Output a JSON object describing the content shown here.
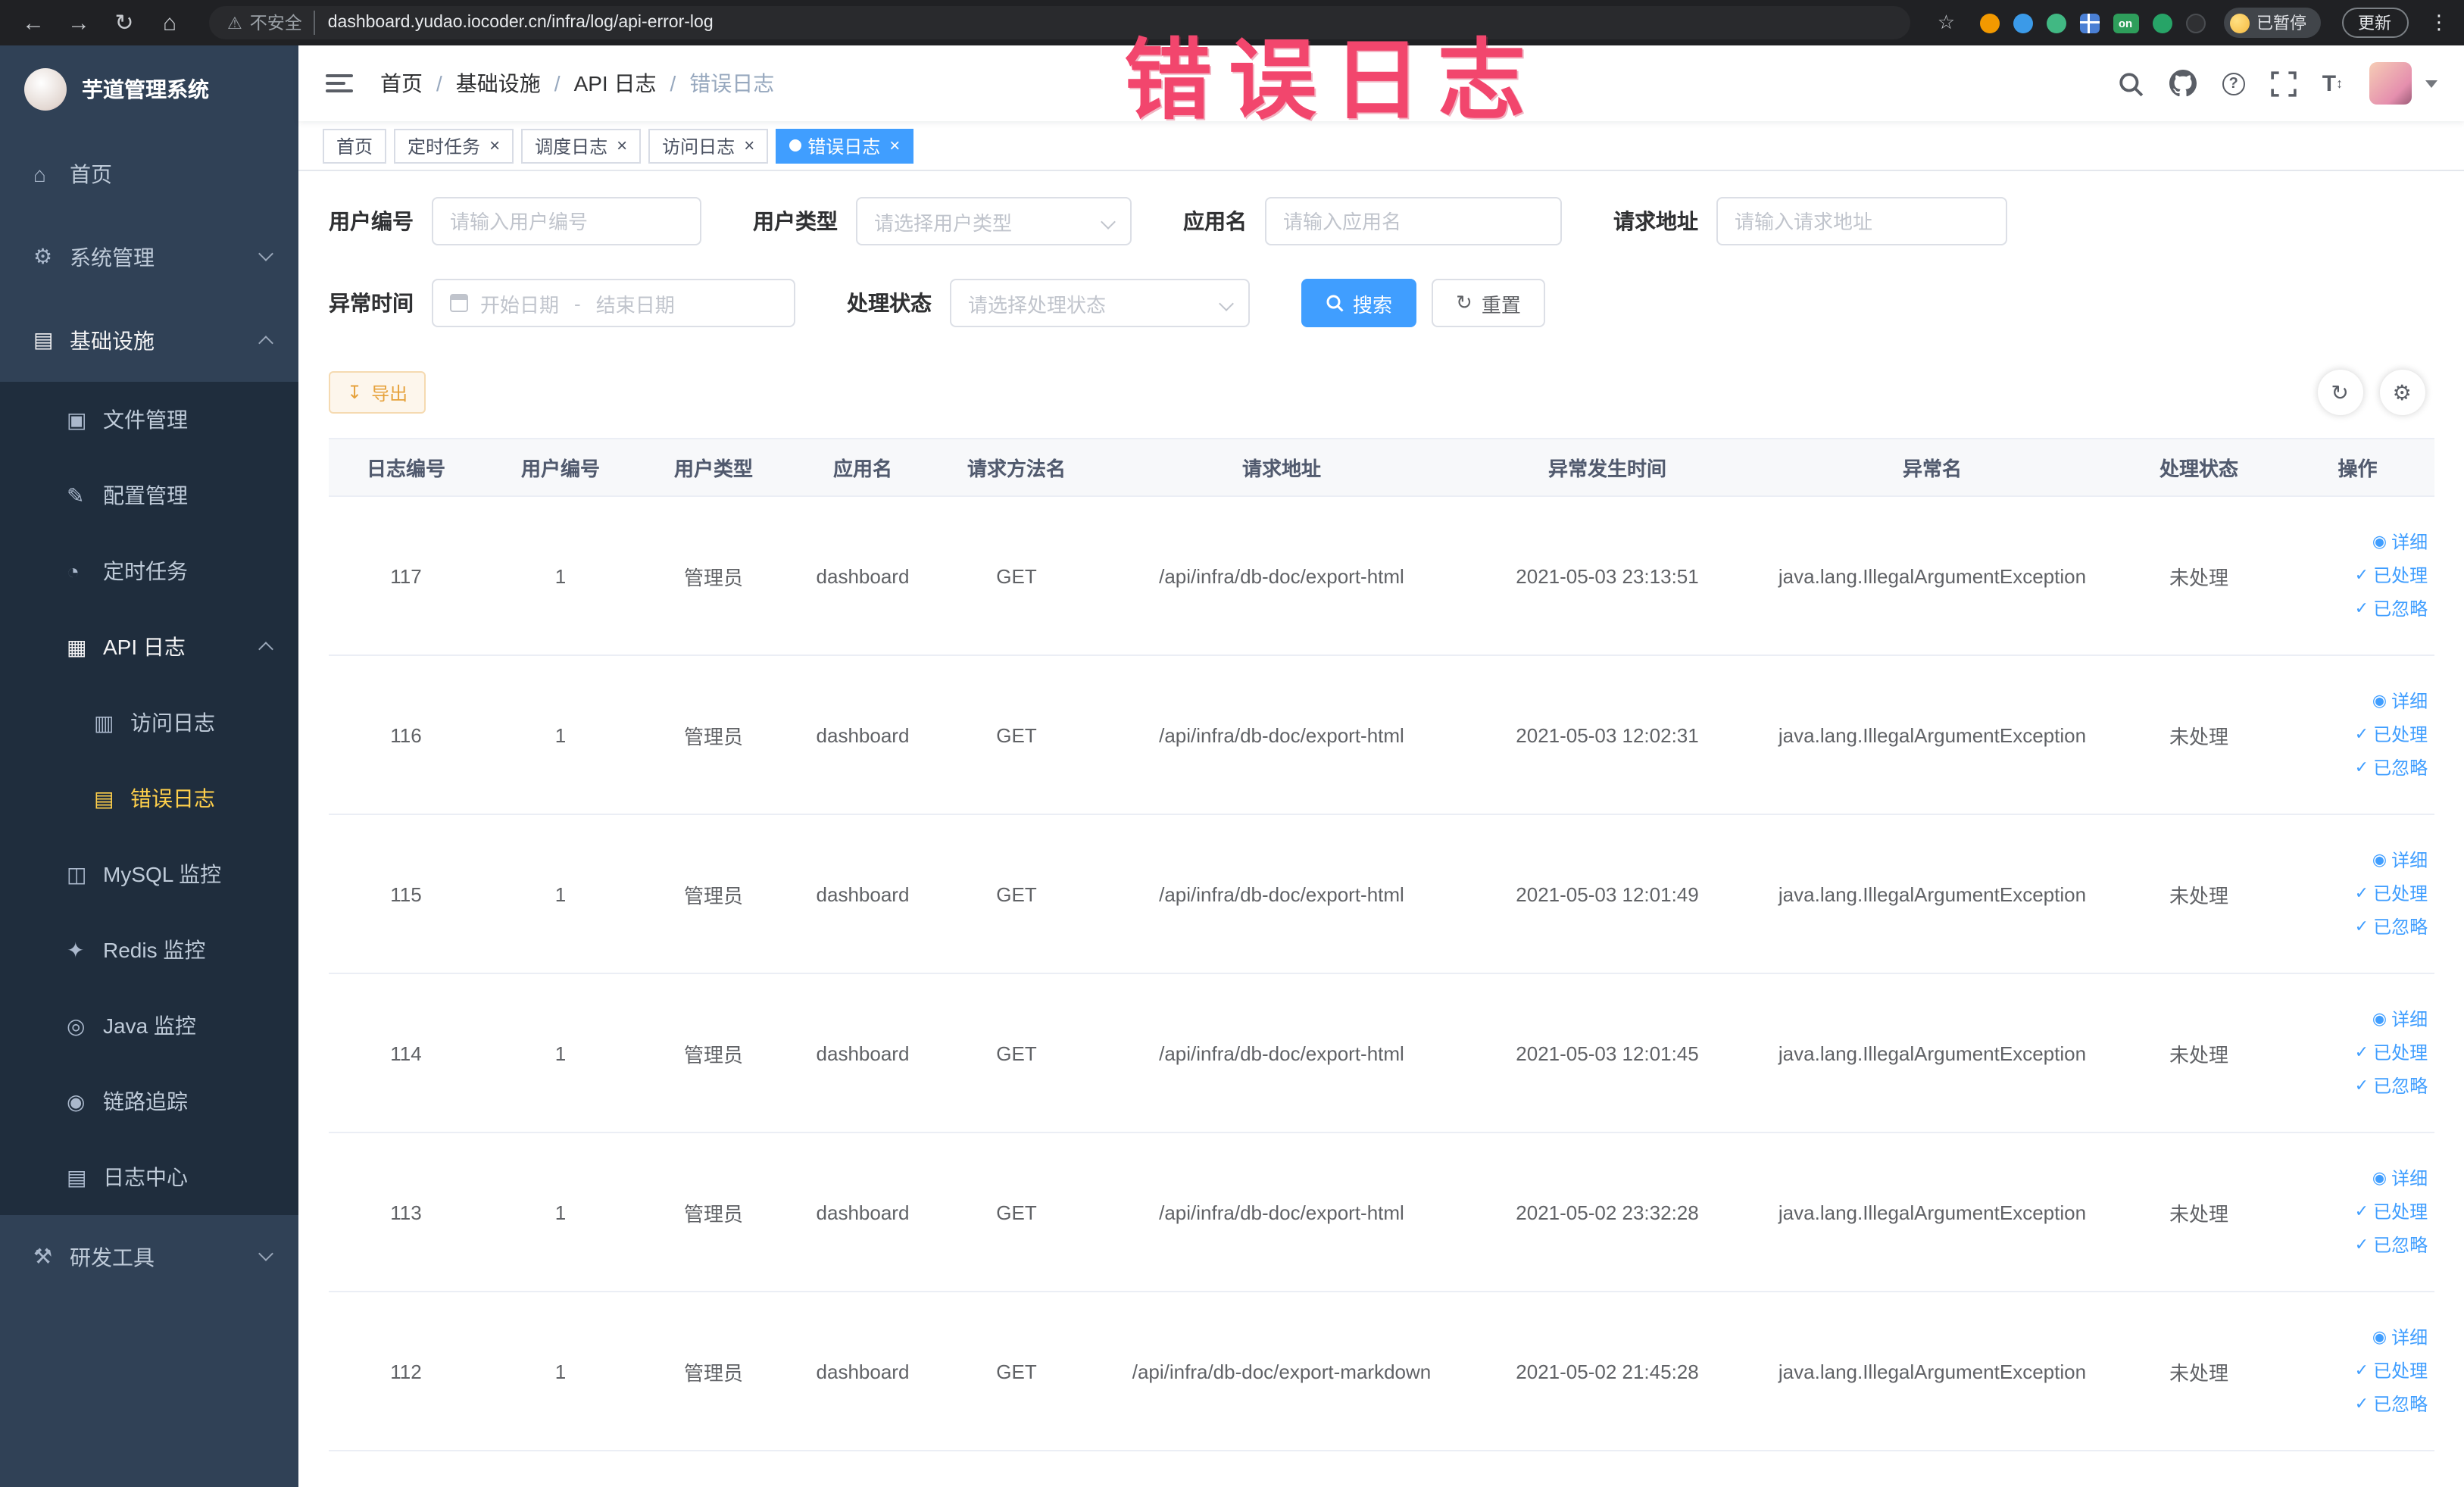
{
  "browser": {
    "security_label": "不安全",
    "url": "dashboard.yudao.iocoder.cn/infra/log/api-error-log",
    "ext_on_label": "on",
    "paused_label": "已暂停",
    "update_label": "更新"
  },
  "annotation": {
    "watermark": "错误日志"
  },
  "sidebar": {
    "logo_title": "芋道管理系统",
    "menu": [
      {
        "label": "首页"
      },
      {
        "label": "系统管理"
      },
      {
        "label": "基础设施",
        "children": [
          {
            "label": "文件管理"
          },
          {
            "label": "配置管理"
          },
          {
            "label": "定时任务"
          },
          {
            "label": "API 日志",
            "children": [
              {
                "label": "访问日志"
              },
              {
                "label": "错误日志"
              }
            ]
          },
          {
            "label": "MySQL 监控"
          },
          {
            "label": "Redis 监控"
          },
          {
            "label": "Java 监控"
          },
          {
            "label": "链路追踪"
          },
          {
            "label": "日志中心"
          }
        ]
      },
      {
        "label": "研发工具"
      }
    ]
  },
  "navbar": {
    "separator": "/",
    "breadcrumb": [
      "首页",
      "基础设施",
      "API 日志",
      "错误日志"
    ]
  },
  "tabs": [
    {
      "label": "首页"
    },
    {
      "label": "定时任务"
    },
    {
      "label": "调度日志"
    },
    {
      "label": "访问日志"
    },
    {
      "label": "错误日志"
    }
  ],
  "filters": {
    "user_id": {
      "label": "用户编号",
      "placeholder": "请输入用户编号"
    },
    "user_type": {
      "label": "用户类型",
      "placeholder": "请选择用户类型"
    },
    "app_name": {
      "label": "应用名",
      "placeholder": "请输入应用名"
    },
    "request_url": {
      "label": "请求地址",
      "placeholder": "请输入请求地址"
    },
    "exception_time": {
      "label": "异常时间",
      "start_placeholder": "开始日期",
      "separator": "-",
      "end_placeholder": "结束日期"
    },
    "process_status": {
      "label": "处理状态",
      "placeholder": "请选择处理状态"
    },
    "search_label": "搜索",
    "reset_label": "重置"
  },
  "toolbar": {
    "export_label": "导出"
  },
  "table": {
    "headers": [
      "日志编号",
      "用户编号",
      "用户类型",
      "应用名",
      "请求方法名",
      "请求地址",
      "异常发生时间",
      "异常名",
      "处理状态",
      "操作"
    ],
    "actions": {
      "detail": "详细",
      "processed": "已处理",
      "ignored": "已忽略"
    },
    "rows": [
      {
        "id": "117",
        "user_id": "1",
        "user_type": "管理员",
        "app": "dashboard",
        "method": "GET",
        "url": "/api/infra/db-doc/export-html",
        "time": "2021-05-03 23:13:51",
        "exception": "java.lang.IllegalArgumentException",
        "status": "未处理"
      },
      {
        "id": "116",
        "user_id": "1",
        "user_type": "管理员",
        "app": "dashboard",
        "method": "GET",
        "url": "/api/infra/db-doc/export-html",
        "time": "2021-05-03 12:02:31",
        "exception": "java.lang.IllegalArgumentException",
        "status": "未处理"
      },
      {
        "id": "115",
        "user_id": "1",
        "user_type": "管理员",
        "app": "dashboard",
        "method": "GET",
        "url": "/api/infra/db-doc/export-html",
        "time": "2021-05-03 12:01:49",
        "exception": "java.lang.IllegalArgumentException",
        "status": "未处理"
      },
      {
        "id": "114",
        "user_id": "1",
        "user_type": "管理员",
        "app": "dashboard",
        "method": "GET",
        "url": "/api/infra/db-doc/export-html",
        "time": "2021-05-03 12:01:45",
        "exception": "java.lang.IllegalArgumentException",
        "status": "未处理"
      },
      {
        "id": "113",
        "user_id": "1",
        "user_type": "管理员",
        "app": "dashboard",
        "method": "GET",
        "url": "/api/infra/db-doc/export-html",
        "time": "2021-05-02 23:32:28",
        "exception": "java.lang.IllegalArgumentException",
        "status": "未处理"
      },
      {
        "id": "112",
        "user_id": "1",
        "user_type": "管理员",
        "app": "dashboard",
        "method": "GET",
        "url": "/api/infra/db-doc/export-markdown",
        "time": "2021-05-02 21:45:28",
        "exception": "java.lang.IllegalArgumentException",
        "status": "未处理"
      }
    ]
  }
}
